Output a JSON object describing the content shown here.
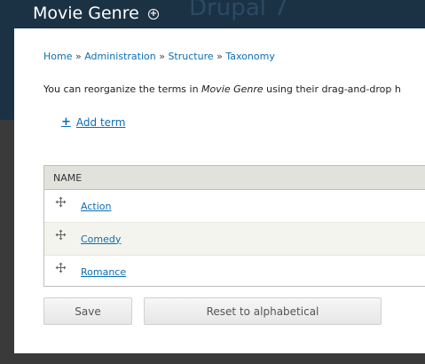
{
  "overlay": {
    "title": "Movie Genre",
    "background_text": "Drupal 7"
  },
  "breadcrumb": {
    "items": [
      "Home",
      "Administration",
      "Structure",
      "Taxonomy"
    ],
    "separator": "»"
  },
  "help": {
    "prefix": "You can reorganize the terms in ",
    "vocabulary": "Movie Genre",
    "suffix": " using their drag-and-drop h"
  },
  "actions": {
    "add_term": "Add term"
  },
  "table": {
    "header_name": "NAME",
    "rows": [
      {
        "name": "Action"
      },
      {
        "name": "Comedy"
      },
      {
        "name": "Romance"
      }
    ]
  },
  "buttons": {
    "save": "Save",
    "reset": "Reset to alphabetical"
  },
  "colors": {
    "link": "#0d6db2",
    "header_dark": "#1b3245",
    "table_header_bg": "#e1e2dc"
  }
}
